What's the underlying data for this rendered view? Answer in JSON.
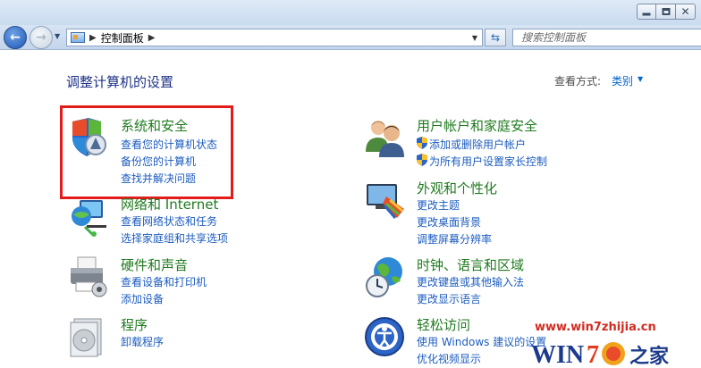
{
  "window": {
    "title_buttons": {
      "minimize_icon": "minimize-icon",
      "maximize_icon": "maximize-icon",
      "close_icon": "close-icon"
    }
  },
  "navbar": {
    "back_icon": "back-arrow-icon",
    "forward_icon": "forward-arrow-icon",
    "address": {
      "crumb": "控制面板"
    },
    "search": {
      "placeholder": "搜索控制面板"
    }
  },
  "content": {
    "title": "调整计算机的设置",
    "view_by": {
      "label": "查看方式:",
      "value": "类别"
    }
  },
  "categories_left": [
    {
      "title": "系统和安全",
      "icon": "security-shield-icon",
      "links": [
        "查看您的计算机状态",
        "备份您的计算机",
        "查找并解决问题"
      ]
    },
    {
      "title": "网络和 Internet",
      "icon": "network-icon",
      "links": [
        "查看网络状态和任务",
        "选择家庭组和共享选项"
      ]
    },
    {
      "title": "硬件和声音",
      "icon": "printer-icon",
      "links": [
        "查看设备和打印机",
        "添加设备"
      ]
    },
    {
      "title": "程序",
      "icon": "programs-icon",
      "links": [
        "卸载程序"
      ]
    }
  ],
  "categories_right": [
    {
      "title": "用户帐户和家庭安全",
      "icon": "users-icon",
      "links": [
        "添加或删除用户帐户",
        "为所有用户设置家长控制"
      ]
    },
    {
      "title": "外观和个性化",
      "icon": "appearance-icon",
      "links": [
        "更改主题",
        "更改桌面背景",
        "调整屏幕分辨率"
      ]
    },
    {
      "title": "时钟、语言和区域",
      "icon": "clock-globe-icon",
      "links": [
        "更改键盘或其他输入法",
        "更改显示语言"
      ]
    },
    {
      "title": "轻松访问",
      "icon": "ease-of-access-icon",
      "links": [
        "使用 Windows 建议的设置",
        "优化视频显示"
      ]
    }
  ],
  "watermark": {
    "url": "www.win7zhijia.cn",
    "logo_text": "Win7之家"
  }
}
